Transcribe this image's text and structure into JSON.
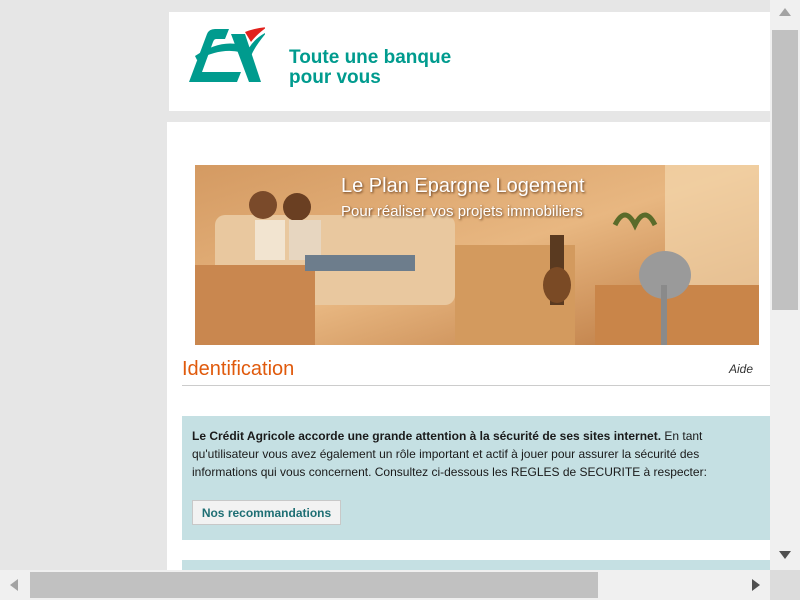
{
  "header": {
    "tagline_line1": "Toute une banque",
    "tagline_line2": "pour vous",
    "brand_colors": {
      "teal": "#009b8e",
      "red": "#e2211c"
    },
    "logo_icon": "credit-agricole-logo"
  },
  "banner": {
    "title": "Le Plan Epargne Logement",
    "subtitle": "Pour réaliser vos projets immobiliers"
  },
  "identification": {
    "title": "Identification",
    "help_link": "Aide",
    "title_color": "#e05a0c"
  },
  "security_notice": {
    "bold_text": "Le Crédit Agricole accorde une grande attention à la sécurité de ses sites internet.",
    "text": " En tant qu'utilisateur vous avez également un rôle important et actif à jouer pour assurer la sécurité des informations qui vous concernent. Consultez ci-dessous les REGLES de SECURITE à respecter:",
    "button_label": "Nos recommandations",
    "box_color": "#c5e0e3"
  },
  "scrollbars": {
    "up_icon": "arrow-up-icon",
    "down_icon": "arrow-down-icon",
    "left_icon": "arrow-left-icon",
    "right_icon": "arrow-right-icon"
  }
}
